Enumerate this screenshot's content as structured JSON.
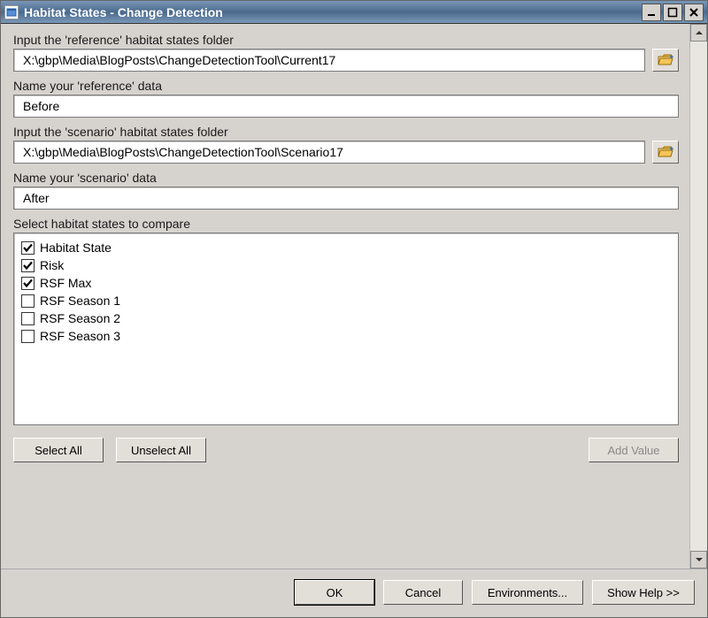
{
  "window": {
    "title": "Habitat States - Change Detection"
  },
  "fields": {
    "ref_folder": {
      "label": "Input the 'reference' habitat states folder",
      "value": "X:\\gbp\\Media\\BlogPosts\\ChangeDetectionTool\\Current17"
    },
    "ref_name": {
      "label": "Name your 'reference' data",
      "value": "Before"
    },
    "scen_folder": {
      "label": "Input the 'scenario' habitat states folder",
      "value": "X:\\gbp\\Media\\BlogPosts\\ChangeDetectionTool\\Scenario17"
    },
    "scen_name": {
      "label": "Name your 'scenario' data",
      "value": "After"
    },
    "compare": {
      "label": "Select habitat states to compare",
      "items": [
        {
          "label": "Habitat State",
          "checked": true
        },
        {
          "label": "Risk",
          "checked": true
        },
        {
          "label": "RSF Max",
          "checked": true
        },
        {
          "label": "RSF Season 1",
          "checked": false
        },
        {
          "label": "RSF Season 2",
          "checked": false
        },
        {
          "label": "RSF Season 3",
          "checked": false
        }
      ]
    }
  },
  "buttons": {
    "select_all": "Select All",
    "unselect_all": "Unselect All",
    "add_value": "Add Value",
    "ok": "OK",
    "cancel": "Cancel",
    "environments": "Environments...",
    "show_help": "Show Help >>"
  }
}
